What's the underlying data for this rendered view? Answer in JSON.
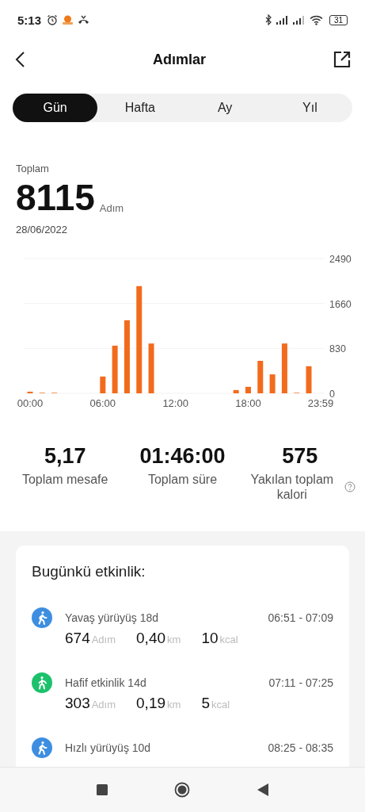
{
  "status_bar": {
    "time": "5:13",
    "battery": "31"
  },
  "header": {
    "title": "Adımlar"
  },
  "tabs": [
    {
      "label": "Gün",
      "selected": true
    },
    {
      "label": "Hafta",
      "selected": false
    },
    {
      "label": "Ay",
      "selected": false
    },
    {
      "label": "Yıl",
      "selected": false
    }
  ],
  "summary": {
    "label": "Toplam",
    "value": "8115",
    "unit": "Adım",
    "date": "28/06/2022"
  },
  "chart_data": {
    "type": "bar",
    "x": [
      0,
      1,
      2,
      3,
      4,
      5,
      6,
      7,
      8,
      9,
      10,
      11,
      12,
      13,
      14,
      15,
      16,
      17,
      18,
      19,
      20,
      21,
      22,
      23
    ],
    "series": [
      {
        "color": "#f26b1d",
        "values": [
          30,
          10,
          10,
          0,
          0,
          0,
          310,
          880,
          1350,
          1980,
          920,
          0,
          0,
          0,
          0,
          0,
          0,
          60,
          120,
          600,
          350,
          920,
          10,
          500
        ]
      }
    ],
    "xlim": [
      0,
      23.98
    ],
    "ylim": [
      0,
      2490
    ],
    "yticks": [
      0,
      830,
      1660,
      2490
    ],
    "xticks": [
      {
        "value": 0,
        "label": "00:00"
      },
      {
        "value": 6,
        "label": "06:00"
      },
      {
        "value": 12,
        "label": "12:00"
      },
      {
        "value": 18,
        "label": "18:00"
      },
      {
        "value": 23.98,
        "label": "23:59"
      }
    ]
  },
  "stats": [
    {
      "value": "5,17",
      "label": "Toplam mesafe",
      "help": false
    },
    {
      "value": "01:46:00",
      "label": "Toplam süre",
      "help": false
    },
    {
      "value": "575",
      "label": "Yakılan toplam kalori",
      "help": true
    }
  ],
  "activity": {
    "title": "Bugünkü etkinlik:",
    "items": [
      {
        "kind": "walk",
        "color": "#3d8ee0",
        "name": "Yavaş yürüyüş 18d",
        "time": "06:51 - 07:09",
        "steps": "674",
        "steps_unit": "Adım",
        "distance": "0,40",
        "distance_unit": "km",
        "calories": "10",
        "calories_unit": "kcal"
      },
      {
        "kind": "light",
        "color": "#1cc16c",
        "name": "Hafif etkinlik 14d",
        "time": "07:11 - 07:25",
        "steps": "303",
        "steps_unit": "Adım",
        "distance": "0,19",
        "distance_unit": "km",
        "calories": "5",
        "calories_unit": "kcal"
      },
      {
        "kind": "walk",
        "color": "#3d8ee0",
        "name": "Hızlı yürüyüş 10d",
        "time": "08:25 - 08:35"
      }
    ]
  }
}
